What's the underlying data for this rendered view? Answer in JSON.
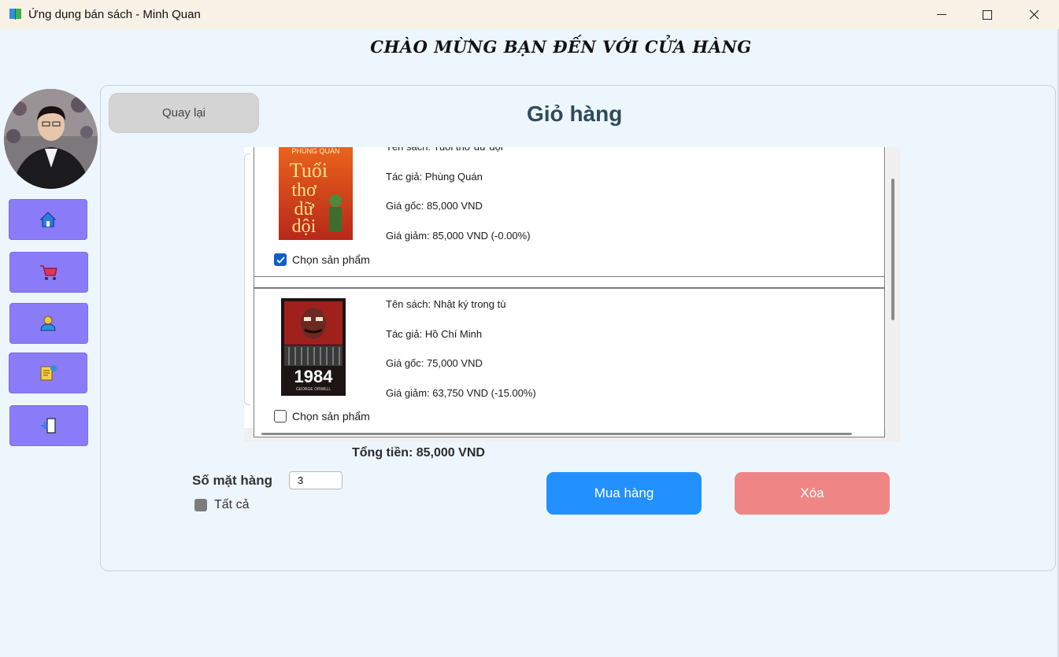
{
  "window": {
    "title": "Ứng dụng bán sách - Minh Quan",
    "controls": {
      "minimize": "─",
      "maximize": "☐",
      "close": "✕"
    }
  },
  "header": {
    "welcome": "CHÀO MỪNG BẠN ĐẾN VỚI CỬA HÀNG"
  },
  "sidebar": {
    "items": [
      {
        "icon": "home-icon"
      },
      {
        "icon": "cart-icon"
      },
      {
        "icon": "user-icon"
      },
      {
        "icon": "orders-icon"
      },
      {
        "icon": "logout-icon"
      }
    ]
  },
  "cart": {
    "back_label": "Quay lại",
    "title": "Giỏ hàng",
    "items": [
      {
        "name": "Tên sách: Tuổi thơ dữ dội",
        "author": "Tác giả: Phùng Quán",
        "price": "Giá gốc: 85,000 VND",
        "sale": "Giá giảm: 85,000 VND (-0.00%)",
        "select_label": "Chọn sản phẩm",
        "checked": true,
        "cover_author": "PHÙNG QUÁN",
        "cover_title_1": "Tuổi",
        "cover_title_2": "thơ",
        "cover_title_3": "dữ",
        "cover_title_4": "dội"
      },
      {
        "name": "Tên sách: Nhật ký trong tù",
        "author": "Tác giả: Hồ Chí Minh",
        "price": "Giá gốc: 75,000 VND",
        "sale": "Giá giảm: 63,750 VND (-15.00%)",
        "select_label": "Chọn sản phẩm",
        "checked": false,
        "cover_title": "1984",
        "cover_author": "GEORGE ORWELL"
      }
    ],
    "total": "Tổng tiền: 85,000 VND",
    "count_label": "Số mặt hàng",
    "count_value": "3",
    "select_all_label": "Tất cả",
    "buy_label": "Mua hàng",
    "delete_label": "Xóa"
  },
  "colors": {
    "sidebar_button": "#8a7cf8",
    "buy": "#2390ff",
    "delete": "#f08585",
    "back": "#d4d4d4"
  }
}
